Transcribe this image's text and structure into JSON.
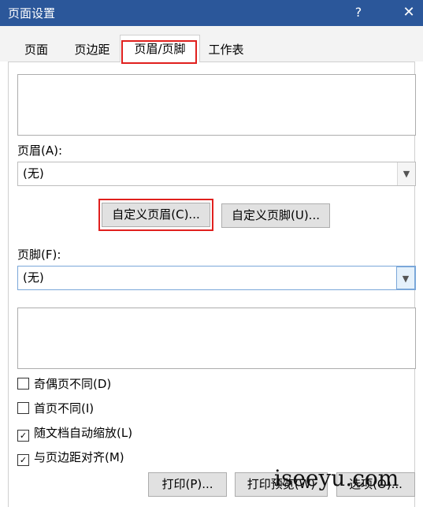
{
  "dialog": {
    "title": "页面设置",
    "help_icon": "?",
    "close_icon": "✕"
  },
  "tabs": [
    {
      "label": "页面"
    },
    {
      "label": "页边距"
    },
    {
      "label": "页眉/页脚"
    },
    {
      "label": "工作表"
    }
  ],
  "header": {
    "label": "页眉(A):",
    "value": "(无)",
    "custom_button": "自定义页眉(C)..."
  },
  "footer": {
    "label": "页脚(F):",
    "value": "(无)",
    "custom_button": "自定义页脚(U)..."
  },
  "options": [
    {
      "label": "奇偶页不同(D)",
      "checked": false
    },
    {
      "label": "首页不同(I)",
      "checked": false
    },
    {
      "label": "随文档自动缩放(L)",
      "checked": true
    },
    {
      "label": "与页边距对齐(M)",
      "checked": true
    }
  ],
  "buttons": {
    "print": "打印(P)...",
    "preview": "打印预览(W)",
    "options": "选项(O)..."
  },
  "watermark": "iseeyu.com",
  "colors": {
    "titlebar": "#2b579a",
    "highlight": "#e0201e"
  }
}
